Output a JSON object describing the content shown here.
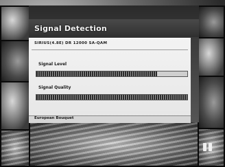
{
  "screen": {
    "title": "Signal Detection",
    "satellite_info": "SIRIUS(4.8E)  DR 12000  SA-QAM",
    "signal_level": {
      "label": "Signal Level",
      "value_fraction": 0.8
    },
    "signal_quality": {
      "label": "Signal Quality",
      "value_fraction": 1.0
    },
    "region": "European Bouquet"
  },
  "icons": {
    "pause": "pause-icon"
  }
}
